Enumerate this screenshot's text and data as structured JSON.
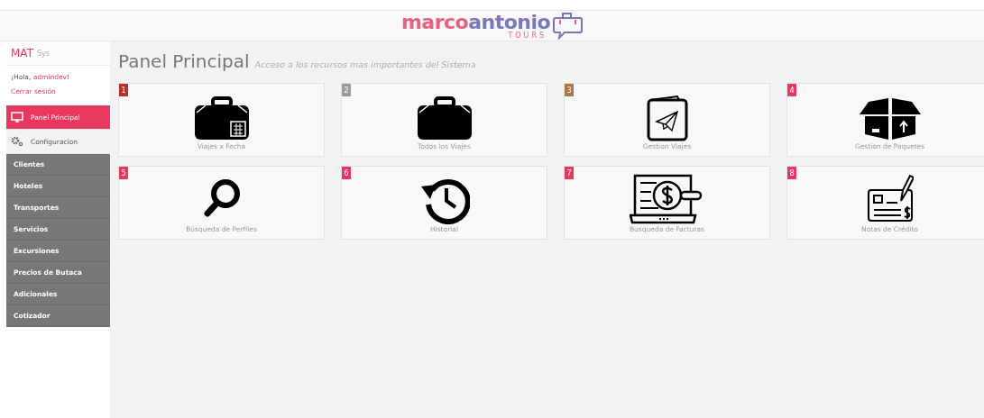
{
  "logo": {
    "first": "marco",
    "second": "antonio",
    "tagline": "TOURS"
  },
  "brand": {
    "name": "MAT",
    "suffix": "Sys"
  },
  "greeting": {
    "prefix": "¡Hola, ",
    "user": "admindev",
    "suffix": "!"
  },
  "logout": "Cerrar sesión",
  "nav": [
    {
      "label": "Panel Principal",
      "selected": true
    },
    {
      "label": "Configuracion",
      "selected": false,
      "children": [
        {
          "label": "Clientes"
        },
        {
          "label": "Hoteles"
        },
        {
          "label": "Transportes"
        },
        {
          "label": "Servicios"
        },
        {
          "label": "Excursiones"
        },
        {
          "label": "Precios de Butaca"
        },
        {
          "label": "Adicionales"
        },
        {
          "label": "Cotizador"
        }
      ]
    }
  ],
  "page": {
    "title": "Panel Principal",
    "subtitle": "Acceso a los recursos mas importantes del Sistema"
  },
  "cards": [
    {
      "number": "1",
      "label": "Viajes x Fecha",
      "color": "#b5302e"
    },
    {
      "number": "2",
      "label": "Todos los Viajes",
      "color": "#9a9a9a"
    },
    {
      "number": "3",
      "label": "Gestion Viajes",
      "color": "#a8784a"
    },
    {
      "number": "4",
      "label": "Gestion de Paquetes",
      "color": "#e8385f"
    },
    {
      "number": "5",
      "label": "Búsqueda de Perfiles",
      "color": "#e8385f"
    },
    {
      "number": "6",
      "label": "Historial",
      "color": "#e8385f"
    },
    {
      "number": "7",
      "label": "Busqueda de Facturas",
      "color": "#e8385f"
    },
    {
      "number": "8",
      "label": "Notas de Crédito",
      "color": "#e8385f"
    }
  ]
}
